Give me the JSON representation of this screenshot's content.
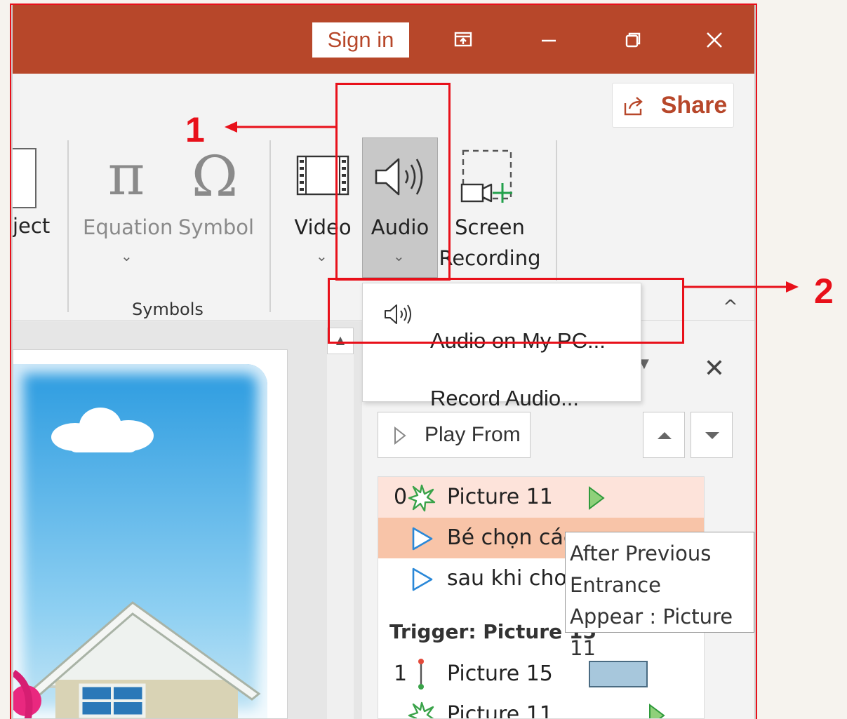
{
  "titlebar": {
    "sign_in_label": "Sign in",
    "colors": {
      "background": "#b7472a",
      "sign_in_text": "#b7472a"
    }
  },
  "ribbon": {
    "share_label": "Share",
    "buttons": {
      "object_label_partial": "ject",
      "equation_label": "Equation",
      "symbol_label": "Symbol",
      "video_label": "Video",
      "audio_label": "Audio",
      "screen_recording_line1": "Screen",
      "screen_recording_line2": "Recording"
    },
    "group_symbols_label": "Symbols",
    "icons": {
      "equation": "π",
      "symbol": "Ω",
      "chevron": "⌄",
      "collapse": "^"
    }
  },
  "audio_menu": {
    "items": [
      {
        "label": "Audio on My PC...",
        "icon": "speaker-icon"
      },
      {
        "label": "Record Audio..."
      }
    ]
  },
  "animation_pane": {
    "play_from_label": "Play From",
    "close_icon": "✕",
    "items": [
      {
        "number": "0",
        "label": "Picture 11",
        "effect_icon": "entrance-star-icon"
      },
      {
        "number": "",
        "label": "Bé chọn các",
        "effect_icon": "play-triangle-icon"
      },
      {
        "number": "",
        "label": "sau khi chơi",
        "effect_icon": "play-triangle-icon"
      }
    ],
    "trigger_label": "Trigger: Picture 15",
    "trigger_items": [
      {
        "number": "1",
        "label": "Picture 15"
      },
      {
        "number": "",
        "label": "Picture 11"
      }
    ]
  },
  "tooltip": {
    "lines": [
      "After Previous",
      "Entrance",
      "Appear : Picture 11"
    ]
  },
  "annotations": {
    "step1": "1",
    "step2": "2",
    "color": "#e8101a"
  }
}
